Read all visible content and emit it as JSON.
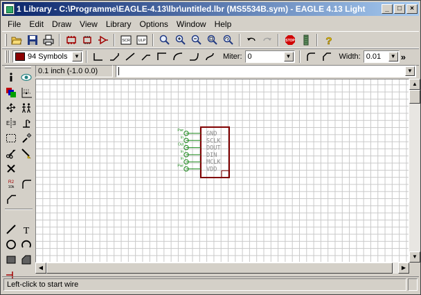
{
  "window": {
    "title": "1 Library - C:\\Programme\\EAGLE-4.13\\lbr\\untitled.lbr (MS5534B.sym) - EAGLE 4.13 Light",
    "controls": {
      "minimize": "_",
      "maximize": "□",
      "close": "×"
    }
  },
  "menu": [
    "File",
    "Edit",
    "Draw",
    "View",
    "Library",
    "Options",
    "Window",
    "Help"
  ],
  "toolbar": {
    "icons": [
      "open-icon",
      "save-icon",
      "print-icon",
      "board-icon",
      "schematic-icon",
      "symbol-icon",
      "script-icon",
      "ulp-icon",
      "zoom-fit-icon",
      "zoom-in-icon",
      "zoom-out-icon",
      "zoom-select-icon",
      "zoom-redraw-icon",
      "undo-icon",
      "redo-icon",
      "stop-icon",
      "go-icon",
      "help-icon"
    ],
    "stop_label": "STOP",
    "script_label": "SCR",
    "ulp_label": "ULP"
  },
  "params": {
    "layer_value": "94 Symbols",
    "layer_color": "#8b0000",
    "miter_label": "Miter:",
    "miter_value": "0",
    "width_label": "Width:",
    "width_value": "0.01",
    "more": "»"
  },
  "command": {
    "coordinate": "0.1 inch (-1.0 0.0)",
    "value": ""
  },
  "tools": [
    "info-icon",
    "display-icon",
    "layer-icon",
    "mark-icon",
    "move-icon",
    "copy-icon",
    "mirror-icon",
    "rotate-icon",
    "group-icon",
    "change-icon",
    "cut-icon",
    "paste-icon",
    "delete-icon",
    "add-icon",
    "name-icon",
    "value-icon",
    "smash-icon",
    "miter-icon",
    "wire-icon",
    "text-icon",
    "circle-icon",
    "arc-icon",
    "rect-icon",
    "polygon-icon",
    "pin-icon"
  ],
  "tool_labels": {
    "name": "R2",
    "value": "10k",
    "text": "T"
  },
  "symbol": {
    "pins": [
      {
        "name": "GND",
        "direction": "Pwr"
      },
      {
        "name": "SCLK",
        "direction": "In"
      },
      {
        "name": "DOUT",
        "direction": "Out"
      },
      {
        "name": "DIN",
        "direction": "In"
      },
      {
        "name": "MCLK",
        "direction": "In"
      },
      {
        "name": "VDD",
        "direction": "Pwr"
      }
    ],
    "colors": {
      "body": "#800000",
      "pin": "#1a8a1a",
      "text": "#8a8a8a"
    }
  },
  "status": {
    "message": "Left-click to start wire"
  }
}
